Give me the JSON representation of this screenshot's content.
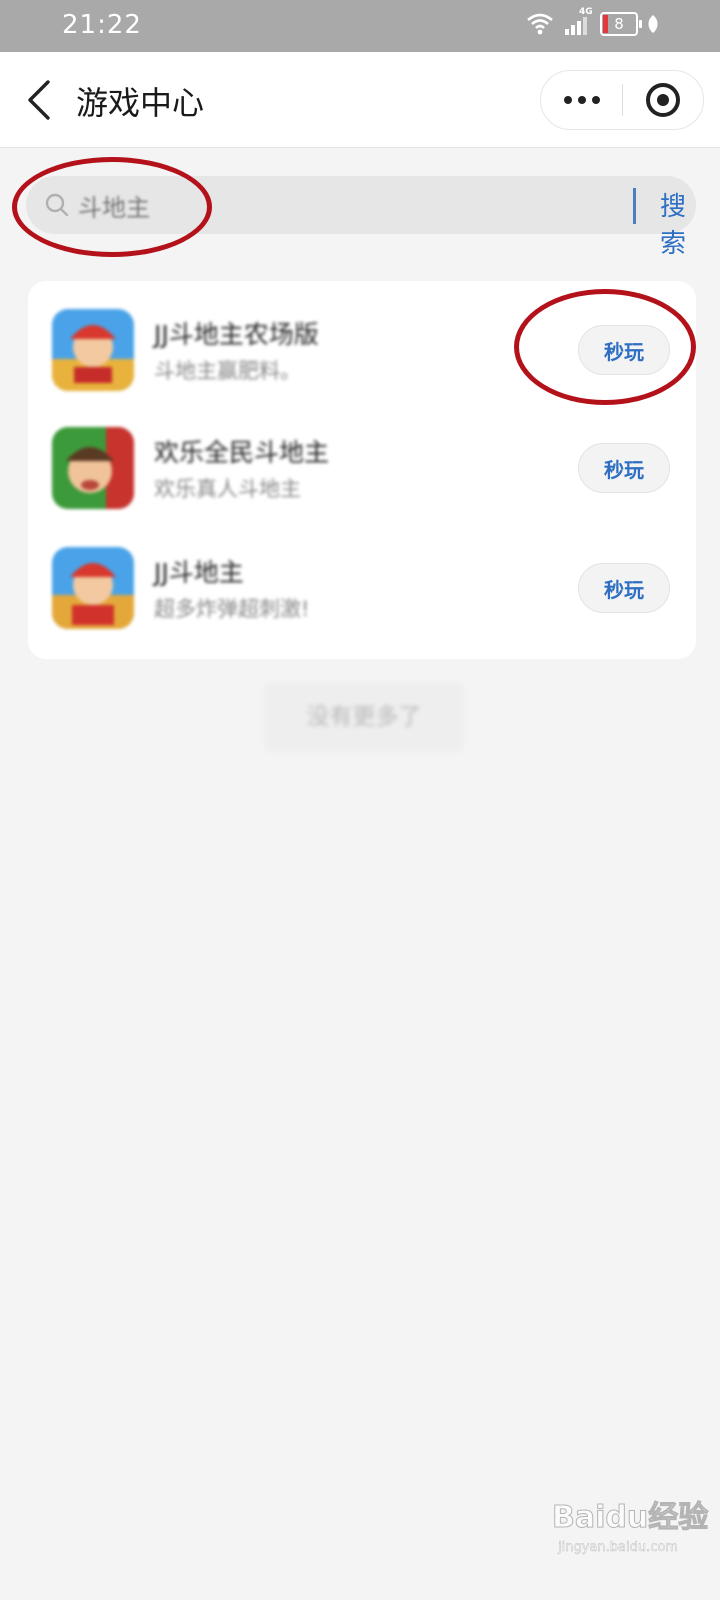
{
  "status_bar": {
    "time": "21:22",
    "network": "4G",
    "battery": "8"
  },
  "nav": {
    "title": "游戏中心"
  },
  "search": {
    "query": "斗地主",
    "button_label": "搜索"
  },
  "results": [
    {
      "name": "JJ斗地主农场版",
      "desc": "斗地主赢肥料。",
      "button": "秒玩"
    },
    {
      "name": "欢乐全民斗地主",
      "desc": "欢乐真人斗地主",
      "button": "秒玩"
    },
    {
      "name": "JJ斗地主",
      "desc": "超多炸弹超刺激!",
      "button": "秒玩"
    }
  ],
  "footer": {
    "no_more": "没有更多了"
  },
  "watermark": {
    "logo": "Baidu经验",
    "url": "jingyan.baidu.com"
  },
  "colors": {
    "accent": "#2e6fc4",
    "annotation": "#b4121a",
    "background": "#f4f4f4"
  },
  "icons": {
    "back": "chevron-left-icon",
    "more": "more-dots-icon",
    "close": "record-icon",
    "search": "search-icon"
  }
}
